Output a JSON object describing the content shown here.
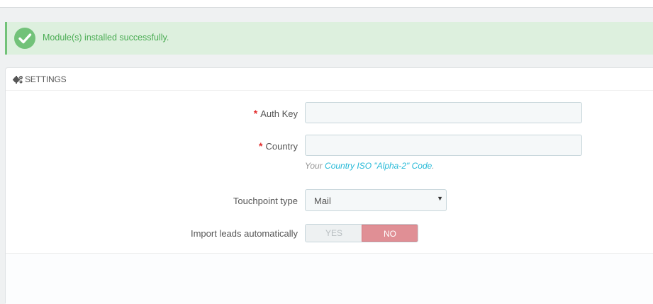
{
  "alert": {
    "message": "Module(s) installed successfully.",
    "icon": "check-circle-icon",
    "color": "#72c279"
  },
  "panel": {
    "title": "SETTINGS",
    "icon": "cogs-icon"
  },
  "form": {
    "required_mark": "*",
    "auth_key": {
      "label": "Auth Key",
      "value": ""
    },
    "country": {
      "label": "Country",
      "value": "",
      "help_prefix": "Your",
      "help_link": "Country ISO \"Alpha-2\" Code",
      "help_suffix": "."
    },
    "touchpoint": {
      "label": "Touchpoint type",
      "selected": "Mail"
    },
    "import_leads": {
      "label": "Import leads automatically",
      "yes": "YES",
      "no": "NO",
      "selected": "NO"
    }
  },
  "colors": {
    "link": "#25b9d7",
    "required": "#e32d2d",
    "switch_off": "#e08f95"
  }
}
